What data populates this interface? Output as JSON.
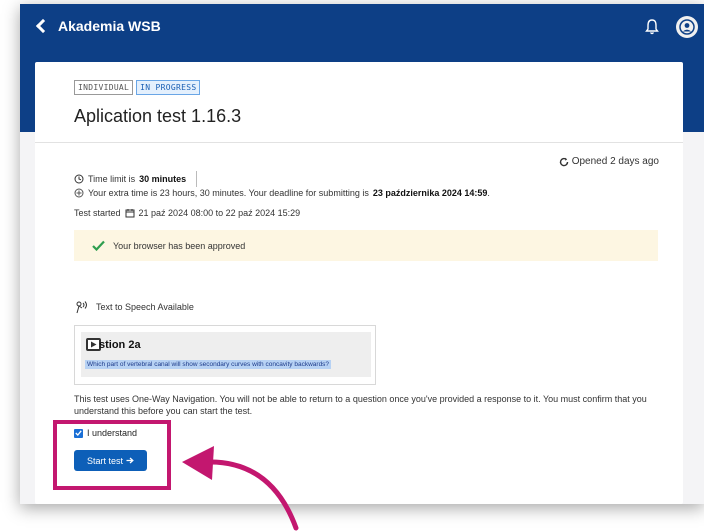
{
  "header": {
    "back_label": "Akademia WSB",
    "bell_icon": "bell-icon",
    "avatar_icon": "user-avatar-icon"
  },
  "test": {
    "badge_individual": "INDIVIDUAL",
    "badge_status": "IN PROGRESS",
    "title": "Aplication test 1.16.3",
    "opened": "Opened 2 days ago",
    "time_limit_prefix": "Time limit is",
    "time_limit_value": "30 minutes",
    "extra_time_prefix": "Your extra time is 23 hours, 30 minutes. Your deadline for submitting is",
    "extra_time_deadline": "23 października 2024 14:59",
    "extra_time_suffix": ".",
    "started_label": "Test started",
    "started_range": "21 paź 2024 08:00 to 22 paź 2024 15:29",
    "browser_approved": "Your browser has been approved",
    "tts_label": "Text to Speech Available",
    "question_title": "stion 2a",
    "question_text": "Which part of vertebral canal will show secondary curves with concavity backwards?",
    "navigation_notice": "This test uses One-Way Navigation. You will not be able to return to a question once you've provided a response to it. You must confirm that you understand this before you can start the test.",
    "understand_label": "I understand",
    "start_button": "Start test",
    "understand_checked": true
  },
  "colors": {
    "brand": "#0d3f86",
    "button": "#0d5fb8",
    "highlight": "#c3176f",
    "approved_bg": "#fdf6e2"
  }
}
